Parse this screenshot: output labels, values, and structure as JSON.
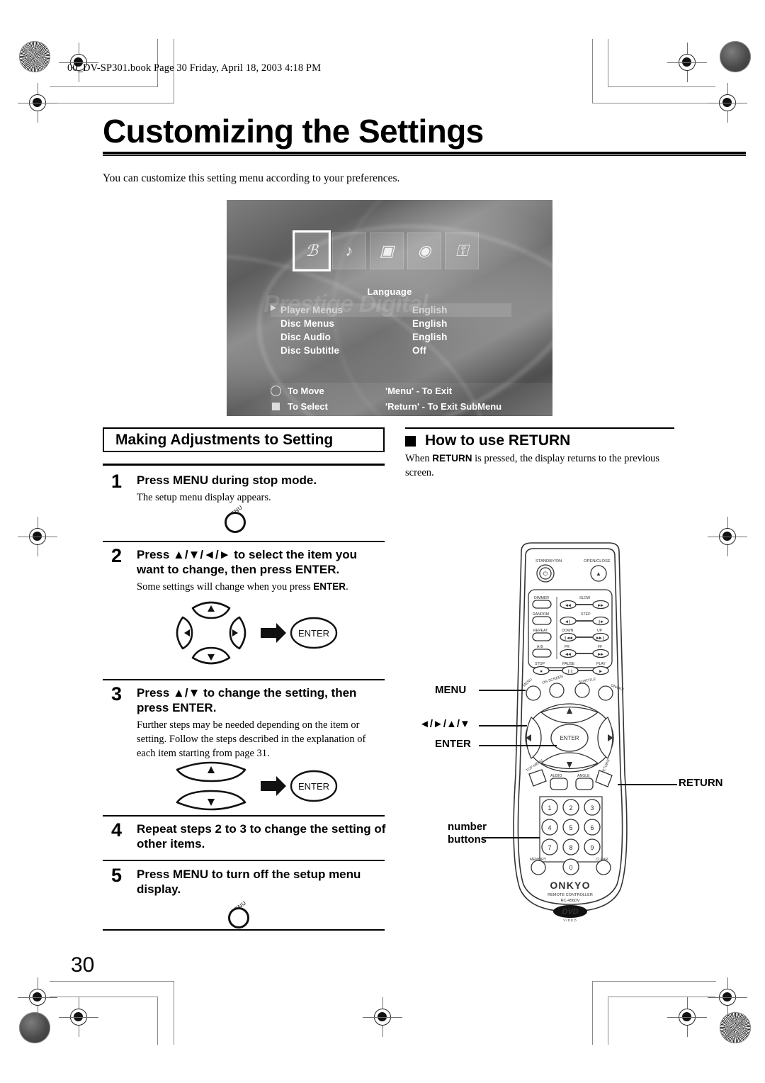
{
  "print": {
    "header_line": "00_DV-SP301.book  Page 30  Friday, April 18, 2003  4:18 PM",
    "page_number": "30"
  },
  "document": {
    "title": "Customizing the Settings",
    "intro": "You can customize this setting menu according to your preferences."
  },
  "osd": {
    "ghost_text": "Prestige Digital",
    "menu_title": "Language",
    "icons": [
      {
        "name": "language-icon",
        "glyph": "ℬ",
        "selected": true
      },
      {
        "name": "audio-icon",
        "glyph": "♪",
        "selected": false
      },
      {
        "name": "display-icon",
        "glyph": "▣",
        "selected": false
      },
      {
        "name": "disc-icon",
        "glyph": "◉",
        "selected": false
      },
      {
        "name": "lock-icon",
        "glyph": "⚿",
        "selected": false
      }
    ],
    "rows": [
      {
        "name": "Player Menus",
        "value": "English",
        "selected": true
      },
      {
        "name": "Disc Menus",
        "value": "English",
        "selected": false
      },
      {
        "name": "Disc Audio",
        "value": "English",
        "selected": false
      },
      {
        "name": "Disc Subtitle",
        "value": "Off",
        "selected": false
      }
    ],
    "footer": [
      {
        "left": "To Move",
        "right": "'Menu' - To Exit"
      },
      {
        "left": "To Select",
        "right": "'Return' - To Exit SubMenu"
      }
    ]
  },
  "left_column": {
    "heading": "Making Adjustments to Setting",
    "steps": [
      {
        "num": "1",
        "head": "Press MENU during stop mode.",
        "body_plain": "The setup menu display appears."
      },
      {
        "num": "2",
        "head": "Press ▲/▼/◄/► to select the item you want to change, then press ENTER.",
        "body_pre": "Some settings will change when you press ",
        "body_bold": "ENTER",
        "body_post": "."
      },
      {
        "num": "3",
        "head": "Press ▲/▼ to change the setting, then press ENTER.",
        "body_plain": "Further steps may be needed depending on the item or setting. Follow the steps described in the explanation of each item starting from page 31."
      },
      {
        "num": "4",
        "head": "Repeat steps 2 to 3 to change the setting of other items.",
        "body_plain": ""
      },
      {
        "num": "5",
        "head": "Press MENU to turn off the setup menu display.",
        "body_plain": ""
      }
    ],
    "menu_button_label": "MENU",
    "enter_button_label": "ENTER"
  },
  "right_column": {
    "heading": "How to use RETURN",
    "body_pre": "When ",
    "body_bold": "RETURN",
    "body_post": " is pressed, the display returns to the previous screen."
  },
  "remote": {
    "callouts": {
      "menu": "MENU",
      "cursor": "◄/►/▲/▼",
      "enter": "ENTER",
      "return": "RETURN",
      "number_line1": "number",
      "number_line2": "buttons"
    },
    "top_buttons": {
      "standby": "STANDBY/ON",
      "open_close": "OPEN/CLOSE"
    },
    "transport_labels": {
      "dimmer": "DIMMER",
      "slow": "SLOW",
      "random": "RANDOM",
      "step": "STEP",
      "repeat": "REPEAT",
      "down": "DOWN",
      "up": "UP",
      "ab": "A-B",
      "fr": "FR",
      "ff": "FF",
      "stop": "STOP",
      "pause": "PAUSE",
      "play": "PLAY"
    },
    "mid_labels": {
      "menu": "MENU",
      "on_screen": "ON SCREEN",
      "subtitle": "SUBTITLE",
      "on_off": "ON/OFF",
      "top_menu": "TOP MENU",
      "audio": "AUDIO",
      "angle": "ANGLE",
      "return": "RETURN",
      "enter": "ENTER"
    },
    "numpad": [
      "1",
      "2",
      "3",
      "4",
      "5",
      "6",
      "7",
      "8",
      "9",
      "0"
    ],
    "numpad_side": {
      "memory": "MEMORY",
      "clear": "CLEAR"
    },
    "brand": "ONKYO",
    "brand_sub1": "REMOTE CONTROLLER",
    "brand_sub2": "RC-456DV",
    "logo": "DVD",
    "logo_sub": "VIDEO"
  },
  "colors": {
    "ink": "#000000",
    "paper": "#ffffff",
    "osd_gray": "#6d6d6d",
    "mark_gray": "#8a8a8a"
  }
}
